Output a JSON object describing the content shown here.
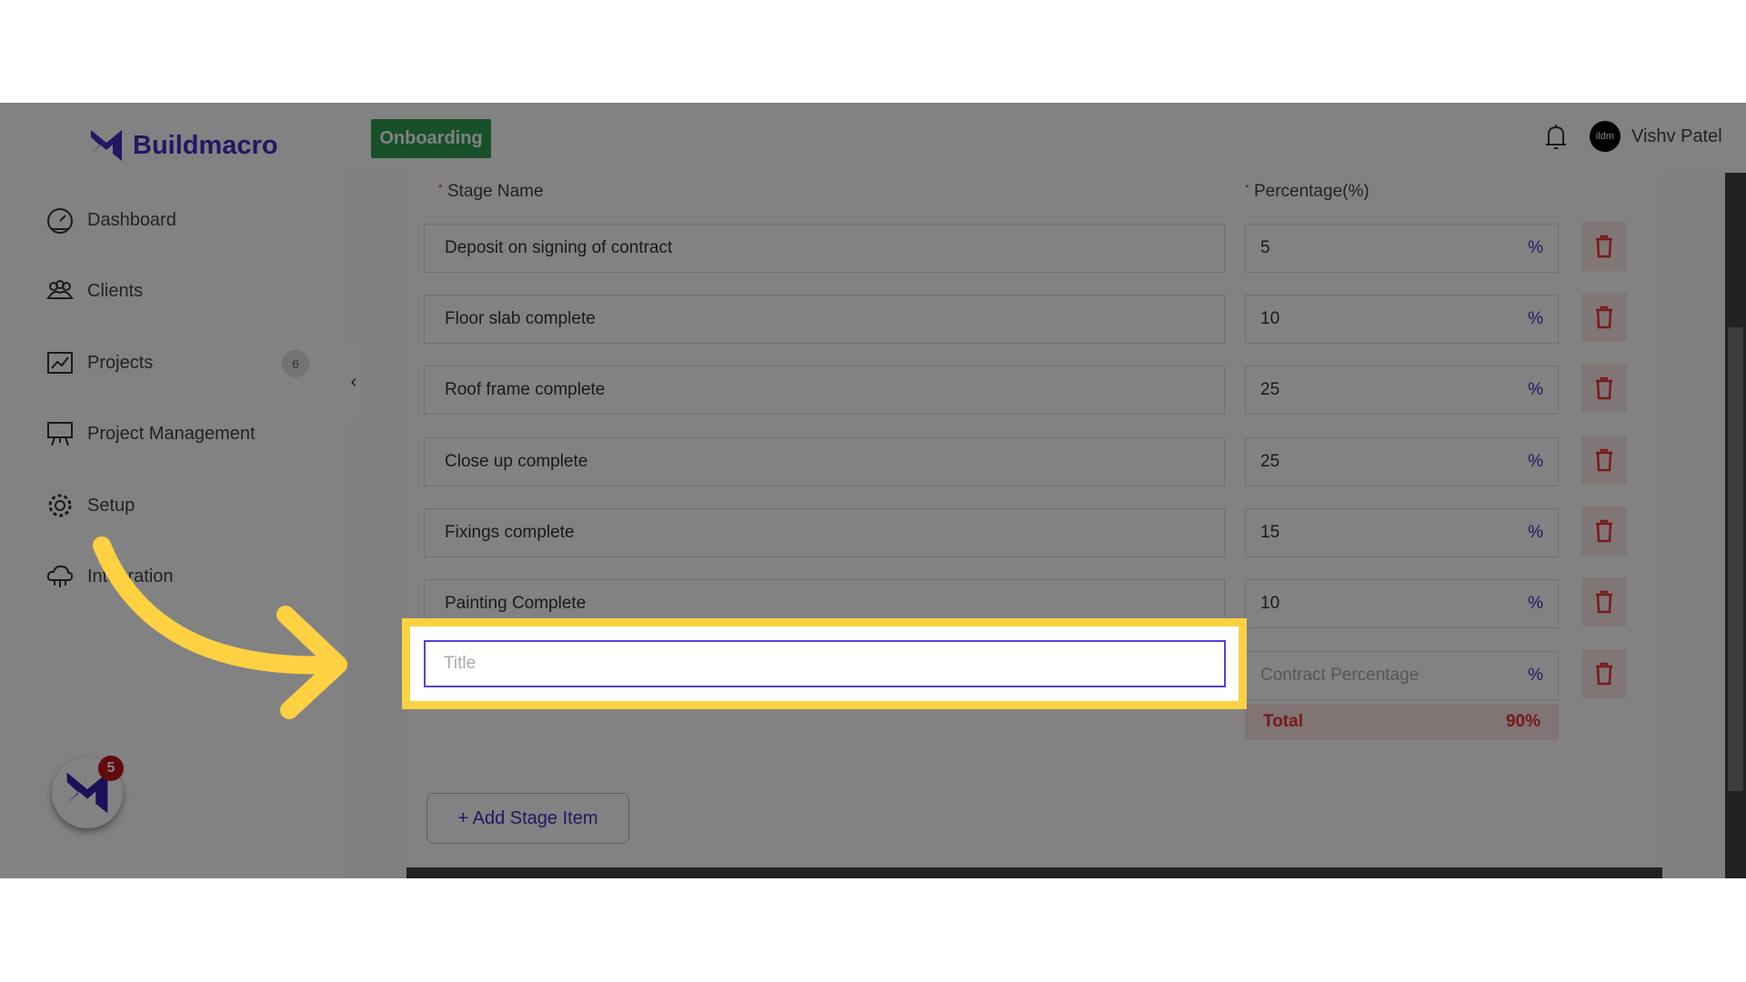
{
  "brand": {
    "name": "Buildmacro",
    "color": "#4a2bc2"
  },
  "header": {
    "onboarding_label": "Onboarding",
    "user_name": "Vishv Patel",
    "avatar_text": "ildm"
  },
  "sidebar": {
    "items": [
      {
        "label": "Dashboard",
        "icon": "dashboard-gauge-icon"
      },
      {
        "label": "Clients",
        "icon": "users-icon"
      },
      {
        "label": "Projects",
        "icon": "chart-line-icon",
        "badge": "6"
      },
      {
        "label": "Project Management",
        "icon": "presentation-board-icon"
      },
      {
        "label": "Setup",
        "icon": "gear-icon"
      },
      {
        "label": "Integration",
        "icon": "cloud-network-icon"
      }
    ]
  },
  "form": {
    "stage_name_label": "Stage Name",
    "percentage_label": "Percentage(%)",
    "percent_sign": "%",
    "rows": [
      {
        "name": "Deposit on signing of contract",
        "percentage": "5"
      },
      {
        "name": "Floor slab complete",
        "percentage": "10"
      },
      {
        "name": "Roof frame complete",
        "percentage": "25"
      },
      {
        "name": "Close up complete",
        "percentage": "25"
      },
      {
        "name": "Fixings complete",
        "percentage": "15"
      },
      {
        "name": "Painting Complete",
        "percentage": "10"
      }
    ],
    "new_row": {
      "title_placeholder": "Title",
      "title_value": "",
      "percentage_placeholder": "Contract Percentage"
    },
    "total_label": "Total",
    "total_value": "90%",
    "add_button_label": "+ Add Stage Item"
  },
  "fab": {
    "badge": "5"
  },
  "colors": {
    "highlight": "#fdd142",
    "delete": "#e33",
    "onboarding": "#2e9e52"
  }
}
